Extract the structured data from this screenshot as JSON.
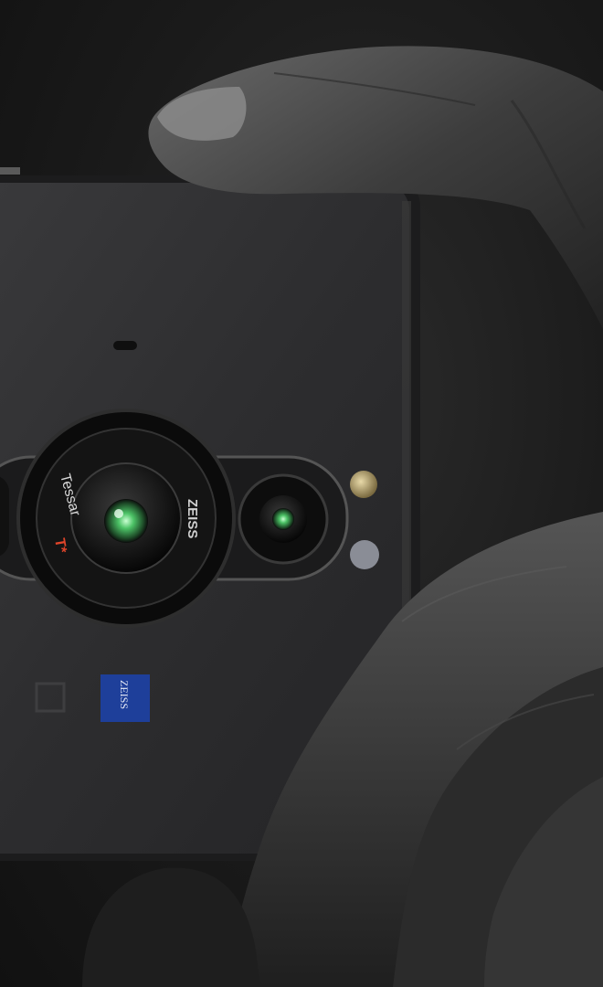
{
  "photo": {
    "lens_brand_text": "ZEISS",
    "lens_model_text": "Tessar",
    "lens_coating_text": "T*",
    "badge_text": "ZEISS",
    "colors": {
      "background": "#161616",
      "phone_body": "#2f2f31",
      "skin": "#3b3b3b",
      "zeiss_blue": "#1e3f9a",
      "lens_green": "#3fbf5a",
      "accent_red": "#e0452a"
    }
  }
}
